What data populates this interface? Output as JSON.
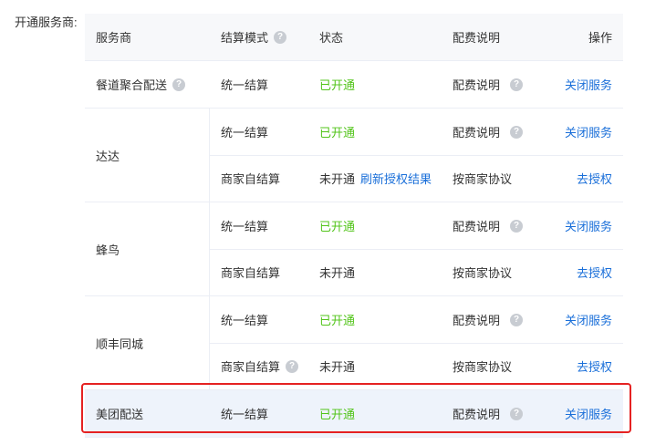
{
  "field_label": "开通服务商:",
  "header": {
    "provider": "服务商",
    "mode": "结算模式",
    "status": "状态",
    "fee": "配费说明",
    "op": "操作"
  },
  "rows": {
    "r0": {
      "provider": "餐道聚合配送",
      "mode": "统一结算",
      "status": "已开通",
      "fee": "配费说明",
      "op": "关闭服务"
    },
    "dada": {
      "provider": "达达",
      "sub1": {
        "mode": "统一结算",
        "status": "已开通",
        "fee": "配费说明",
        "op": "关闭服务"
      },
      "sub2": {
        "mode": "商家自结算",
        "status": "未开通",
        "refresh": "刷新授权结果",
        "fee": "按商家协议",
        "op": "去授权"
      }
    },
    "fengniao": {
      "provider": "蜂鸟",
      "sub1": {
        "mode": "统一结算",
        "status": "已开通",
        "fee": "配费说明",
        "op": "关闭服务"
      },
      "sub2": {
        "mode": "商家自结算",
        "status": "未开通",
        "fee": "按商家协议",
        "op": "去授权"
      }
    },
    "shunfeng": {
      "provider": "顺丰同城",
      "sub1": {
        "mode": "统一结算",
        "status": "已开通",
        "fee": "配费说明",
        "op": "关闭服务"
      },
      "sub2": {
        "mode": "商家自结算",
        "status": "未开通",
        "fee": "按商家协议",
        "op": "去授权"
      }
    },
    "meituan": {
      "provider": "美团配送",
      "mode": "统一结算",
      "status": "已开通",
      "fee": "配费说明",
      "op": "关闭服务"
    }
  },
  "help_glyph": "?",
  "colors": {
    "active": "#52c41a",
    "link": "#1a6fd9",
    "highlight": "#e52222"
  }
}
